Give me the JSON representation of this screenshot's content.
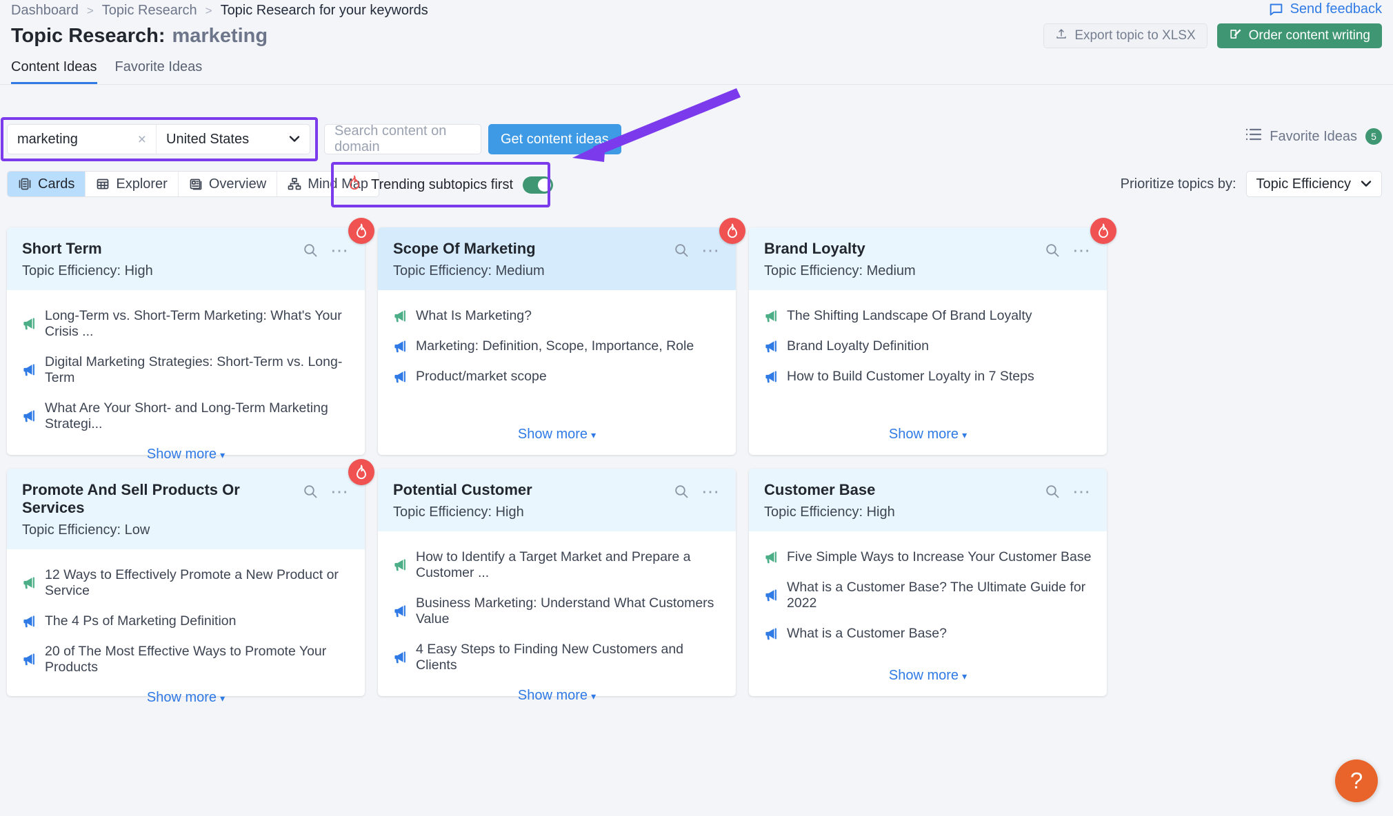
{
  "breadcrumb": {
    "items": [
      "Dashboard",
      "Topic Research",
      "Topic Research for your keywords"
    ],
    "separator": ">"
  },
  "send_feedback": {
    "label": "Send feedback",
    "icon": "feedback-icon",
    "color": "#2f7ae5"
  },
  "header": {
    "title_prefix": "Topic Research:",
    "keyword": "marketing",
    "export_label": "Export topic to XLSX",
    "order_label": "Order content writing",
    "order_color": "#3f9673"
  },
  "tabs": [
    {
      "label": "Content Ideas",
      "active": true
    },
    {
      "label": "Favorite Ideas",
      "active": false
    }
  ],
  "filters": {
    "keyword_value": "marketing",
    "keyword_clear": "×",
    "country": "United States",
    "domain_placeholder": "Search content on domain",
    "domain_value": "",
    "get_ideas_label": "Get content ideas",
    "get_ideas_color": "#3e9ae4"
  },
  "favorite_ideas": {
    "label": "Favorite Ideas",
    "count": "5",
    "badge_color": "#3f9673"
  },
  "views": [
    {
      "label": "Cards",
      "icon": "cards-icon",
      "active": true
    },
    {
      "label": "Explorer",
      "icon": "table-icon",
      "active": false
    },
    {
      "label": "Overview",
      "icon": "overview-icon",
      "active": false
    },
    {
      "label": "Mind Map",
      "icon": "mindmap-icon",
      "active": false
    }
  ],
  "trending": {
    "label": "Trending subtopics first",
    "icon": "flame-icon",
    "on": true,
    "toggle_color": "#3f9673"
  },
  "prioritize": {
    "label": "Prioritize topics by:",
    "value": "Topic Efficiency"
  },
  "annotation": {
    "highlight_color": "#7c3aed"
  },
  "cards": [
    {
      "title": "Short Term",
      "efficiency": "Topic Efficiency: High",
      "trending": true,
      "hovered": false,
      "ideas": [
        {
          "text": "Long-Term vs. Short-Term Marketing: What's Your Crisis ...",
          "color": "green"
        },
        {
          "text": "Digital Marketing Strategies: Short-Term vs. Long-Term",
          "color": "blue"
        },
        {
          "text": "What Are Your Short- and Long-Term Marketing Strategi...",
          "color": "blue"
        }
      ],
      "show_more": "Show more"
    },
    {
      "title": "Scope Of Marketing",
      "efficiency": "Topic Efficiency: Medium",
      "trending": true,
      "hovered": true,
      "ideas": [
        {
          "text": "What Is Marketing?",
          "color": "green"
        },
        {
          "text": "Marketing: Definition, Scope, Importance, Role",
          "color": "blue"
        },
        {
          "text": "Product/market scope",
          "color": "blue"
        }
      ],
      "show_more": "Show more"
    },
    {
      "title": "Brand Loyalty",
      "efficiency": "Topic Efficiency: Medium",
      "trending": true,
      "hovered": false,
      "ideas": [
        {
          "text": "The Shifting Landscape Of Brand Loyalty",
          "color": "green"
        },
        {
          "text": "Brand Loyalty Definition",
          "color": "blue"
        },
        {
          "text": "How to Build Customer Loyalty in 7 Steps",
          "color": "blue"
        }
      ],
      "show_more": "Show more"
    },
    {
      "title": "Promote And Sell Products Or Services",
      "efficiency": "Topic Efficiency: Low",
      "trending": true,
      "hovered": false,
      "ideas": [
        {
          "text": "12 Ways to Effectively Promote a New Product or Service",
          "color": "green"
        },
        {
          "text": "The 4 Ps of Marketing Definition",
          "color": "blue"
        },
        {
          "text": "20 of The Most Effective Ways to Promote Your Products",
          "color": "blue"
        }
      ],
      "show_more": "Show more"
    },
    {
      "title": "Potential Customer",
      "efficiency": "Topic Efficiency: High",
      "trending": false,
      "hovered": false,
      "ideas": [
        {
          "text": "How to Identify a Target Market and Prepare a Customer ...",
          "color": "green"
        },
        {
          "text": "Business Marketing: Understand What Customers Value",
          "color": "blue"
        },
        {
          "text": "4 Easy Steps to Finding New Customers and Clients",
          "color": "blue"
        }
      ],
      "show_more": "Show more"
    },
    {
      "title": "Customer Base",
      "efficiency": "Topic Efficiency: High",
      "trending": false,
      "hovered": false,
      "ideas": [
        {
          "text": "Five Simple Ways to Increase Your Customer Base",
          "color": "green"
        },
        {
          "text": "What is a Customer Base? The Ultimate Guide for 2022",
          "color": "blue"
        },
        {
          "text": "What is a Customer Base?",
          "color": "blue"
        }
      ],
      "show_more": "Show more"
    }
  ],
  "help_fab": {
    "label": "?",
    "color": "#e8642a"
  }
}
